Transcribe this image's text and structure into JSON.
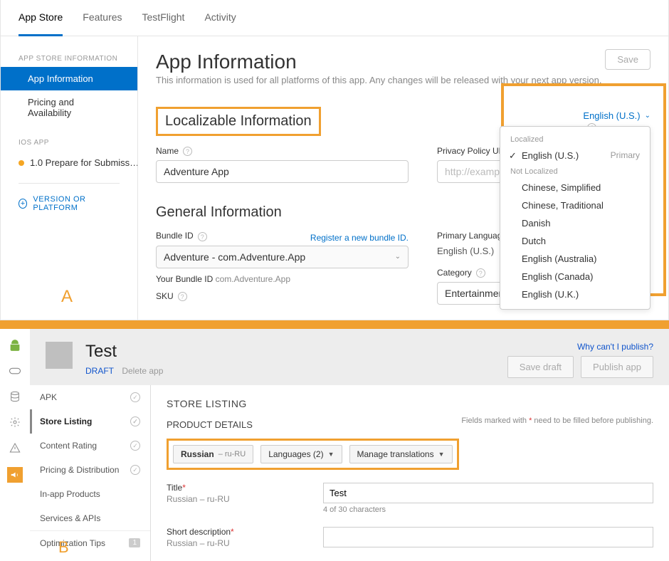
{
  "asc": {
    "tabs": [
      "App Store",
      "Features",
      "TestFlight",
      "Activity"
    ],
    "side": {
      "sec1_label": "APP STORE INFORMATION",
      "items1": [
        "App Information",
        "Pricing and Availability"
      ],
      "sec2_label": "IOS APP",
      "version_item": "1.0 Prepare for Submiss…",
      "add_label": "VERSION OR PLATFORM"
    },
    "main": {
      "title": "App Information",
      "subtitle": "This information is used for all platforms of this app. Any changes will be released with your next app version.",
      "save": "Save",
      "loc_heading": "Localizable Information",
      "lang_selected": "English (U.S.)",
      "name_label": "Name",
      "name_value": "Adventure App",
      "ppu_label": "Privacy Policy URL",
      "ppu_placeholder": "http://example.com/",
      "gen_heading": "General Information",
      "bundle_label": "Bundle ID",
      "bundle_value": "Adventure - com.Adventure.App",
      "register_link": "Register a new bundle ID.",
      "your_bundle_label": "Your Bundle ID",
      "your_bundle_value": "com.Adventure.App",
      "sku_label": "SKU",
      "primary_lang_label": "Primary Language",
      "primary_lang_value": "English (U.S.)",
      "category_label": "Category",
      "category_value": "Entertainment"
    },
    "lang_pop": {
      "group1": "Localized",
      "item_en": "English (U.S.)",
      "primary": "Primary",
      "group2": "Not Localized",
      "items": [
        "Chinese, Simplified",
        "Chinese, Traditional",
        "Danish",
        "Dutch",
        "English (Australia)",
        "English (Canada)",
        "English (U.K.)"
      ]
    },
    "letter": "A"
  },
  "gpc": {
    "title": "Test",
    "draft": "DRAFT",
    "delete": "Delete app",
    "why": "Why can't I publish?",
    "save_draft": "Save draft",
    "publish": "Publish app",
    "nav": [
      "APK",
      "Store Listing",
      "Content Rating",
      "Pricing & Distribution",
      "In-app Products",
      "Services & APIs",
      "Optimization Tips"
    ],
    "nav_badge": "1",
    "h": "STORE LISTING",
    "sh": "PRODUCT DETAILS",
    "req_note_pre": "Fields marked with ",
    "req_note_post": " need to be filled before publishing.",
    "pill_lang": "Russian",
    "pill_lang_sub": "– ru-RU",
    "pill_count": "Languages (2)",
    "pill_manage": "Manage translations",
    "title_label": "Title",
    "lang_sub": "Russian – ru-RU",
    "title_value": "Test",
    "title_count": "4 of 30 characters",
    "short_label": "Short description",
    "letter": "B"
  }
}
